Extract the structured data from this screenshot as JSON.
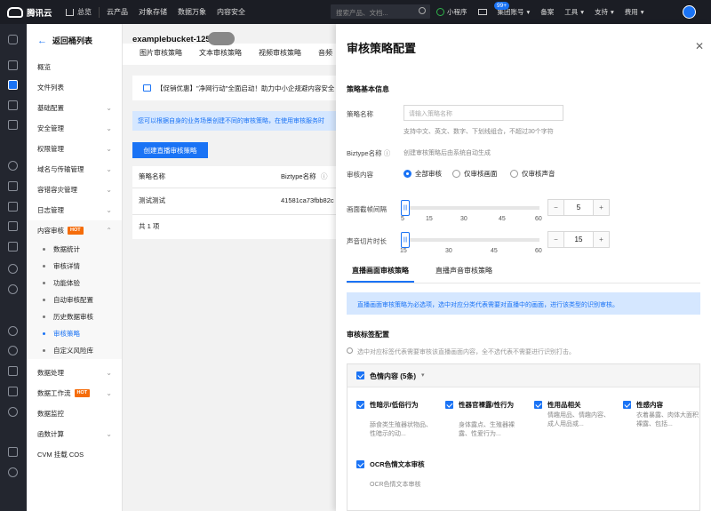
{
  "topbar": {
    "brand": "腾讯云",
    "home": "总览",
    "nav": [
      "云产品",
      "对象存储",
      "数据万象",
      "内容安全"
    ],
    "search_placeholder": "搜索产品、文档...",
    "mini_program": "小程序",
    "badge": "99+",
    "account": "集团账号",
    "beian": "备案",
    "tools": "工具",
    "support": "支持",
    "fees": "费用"
  },
  "sidebar": {
    "back": "返回桶列表",
    "items": [
      {
        "label": "概览"
      },
      {
        "label": "文件列表"
      },
      {
        "label": "基础配置"
      },
      {
        "label": "安全管理"
      },
      {
        "label": "权限管理"
      },
      {
        "label": "域名与传输管理"
      },
      {
        "label": "容错容灾管理"
      },
      {
        "label": "日志管理"
      },
      {
        "label": "内容审核",
        "hot": "HOT"
      }
    ],
    "sub_items": [
      "数据统计",
      "审核详情",
      "功能体验",
      "自动审核配置",
      "历史数据审核",
      "审核策略",
      "自定义风险库"
    ],
    "bottom_items": [
      {
        "label": "数据处理"
      },
      {
        "label": "数据工作流",
        "hot": "HOT"
      },
      {
        "label": "数据监控"
      },
      {
        "label": "函数计算"
      },
      {
        "label": "CVM 挂载 COS"
      }
    ]
  },
  "main": {
    "bucket": "examplebucket-125",
    "tabs": [
      "图片审核策略",
      "文本审核策略",
      "视频审核策略",
      "音频"
    ],
    "notice": "【促销优惠】\"净网行动\"全面启动！助力中小企规避内容安全",
    "info": "您可以根据自身的业务场景创建不同的审核策略，在使用审核服务时",
    "create_button": "创建直播审核策略",
    "table": {
      "headers": [
        "策略名称",
        "Biztype名称"
      ],
      "rows": [
        [
          "测试测试",
          "41581ca73fbb82c"
        ]
      ],
      "total": "共 1 项"
    }
  },
  "drawer": {
    "title": "审核策略配置",
    "close": "✕",
    "basic_section": "策略基本信息",
    "name_label": "策略名称",
    "name_placeholder": "请输入策略名称",
    "name_hint": "支持中文、英文、数字、下划线组合，不超过30个字符",
    "biztype_label": "Biztype名称",
    "biztype_hint": "创建审核策略后由系统自动生成",
    "content_label": "审核内容",
    "content_options": [
      "全部审核",
      "仅审核画面",
      "仅审核声音"
    ],
    "content_selected": 0,
    "frame_label": "画面截帧间隔",
    "frame_ticks": [
      "5",
      "15",
      "30",
      "45",
      "60"
    ],
    "frame_value": "5",
    "audio_label": "声音切片时长",
    "audio_ticks": [
      "15",
      "30",
      "45",
      "60"
    ],
    "audio_value": "15",
    "slider_min_fraction": 0,
    "tabs": [
      "直播画面审核策略",
      "直播声音审核策略"
    ],
    "tab_selected": 0,
    "tab_info": "直播画面审核策略为必选项，选中对应分类代表需要对直播中的画面，进行该类型的识别审核。",
    "labels_section": "审核标签配置",
    "labels_hint": "选中对应标签代表需要审核该直播画面内容，全不选代表不需要进行识别打击。",
    "category": "色情内容 (5条)",
    "items": [
      {
        "title": "性暗示/低俗行为",
        "desc": "舔食类生殖器状物品、性暗示的动..."
      },
      {
        "title": "性器官裸露/性行为",
        "desc": "身体露点、生殖器裸露、性爱行为..."
      },
      {
        "title": "性用品相关",
        "desc": "情趣用品、情趣内容、成人用品或..."
      },
      {
        "title": "性感内容",
        "desc": "衣着暴露、肉体大面积裸露、包括..."
      },
      {
        "title": "OCR色情文本审核",
        "desc": "OCR色情文本审核"
      }
    ],
    "colors": {
      "accent": "#1a73f5",
      "hot": "#f56c0a"
    }
  }
}
